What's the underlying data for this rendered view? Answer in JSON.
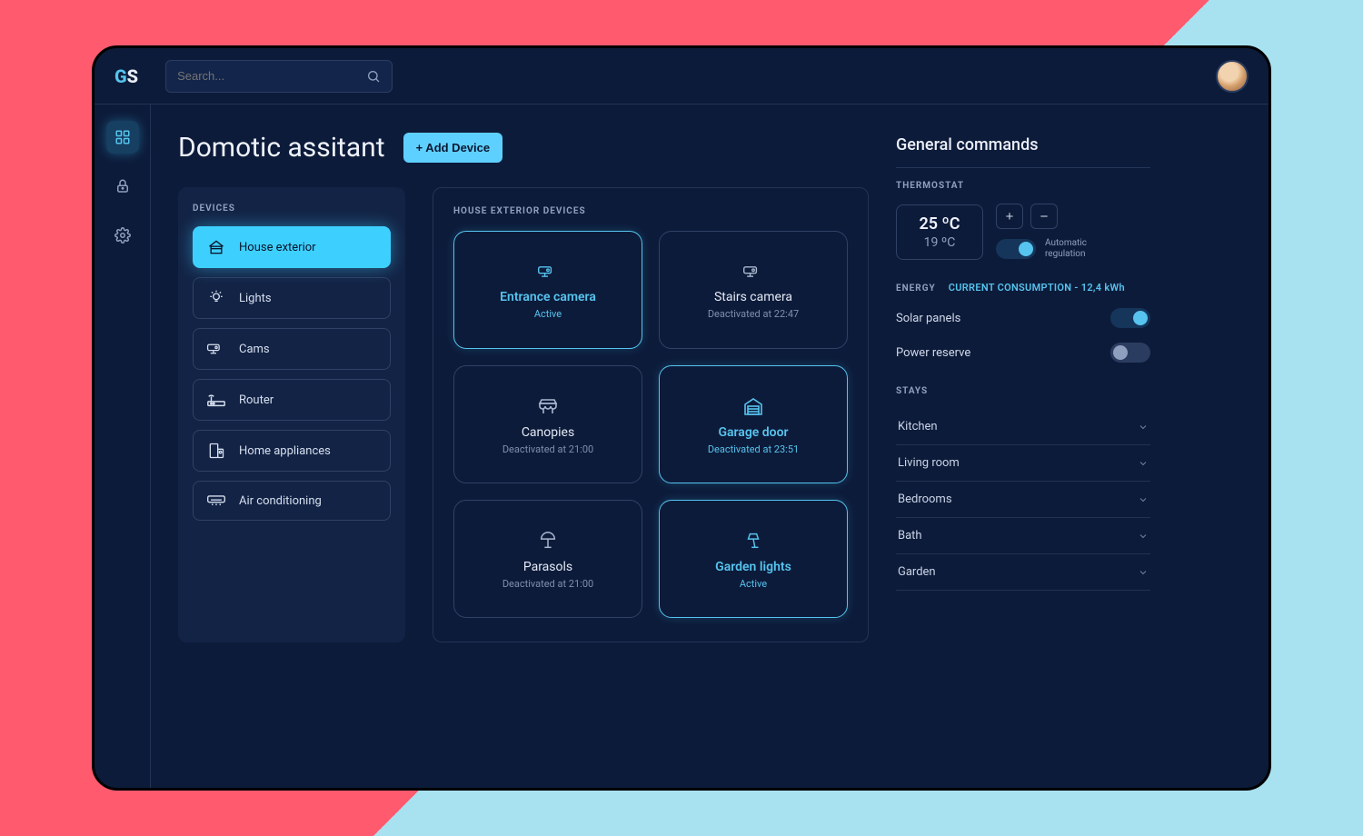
{
  "logo": {
    "g": "G",
    "s": "S"
  },
  "search": {
    "placeholder": "Search..."
  },
  "rail": [
    {
      "name": "dashboard-icon",
      "active": true
    },
    {
      "name": "lock-icon",
      "active": false
    },
    {
      "name": "gear-icon",
      "active": false
    }
  ],
  "page": {
    "title": "Domotic assitant",
    "add_button": "+ Add Device"
  },
  "devices_panel": {
    "label": "DEVICES",
    "items": [
      {
        "icon": "house-icon",
        "label": "House exterior",
        "active": true
      },
      {
        "icon": "lightbulb-icon",
        "label": "Lights",
        "active": false
      },
      {
        "icon": "camera-icon",
        "label": "Cams",
        "active": false
      },
      {
        "icon": "router-icon",
        "label": "Router",
        "active": false
      },
      {
        "icon": "appliance-icon",
        "label": "Home appliances",
        "active": false
      },
      {
        "icon": "ac-icon",
        "label": "Air conditioning",
        "active": false
      }
    ]
  },
  "cards": {
    "label": "HOUSE EXTERIOR DEVICES",
    "items": [
      {
        "icon": "camera-icon",
        "name": "Entrance camera",
        "status": "Active",
        "active": true
      },
      {
        "icon": "camera-icon",
        "name": "Stairs camera",
        "status": "Deactivated at 22:47",
        "active": false
      },
      {
        "icon": "canopy-icon",
        "name": "Canopies",
        "status": "Deactivated at 21:00",
        "active": false
      },
      {
        "icon": "garage-icon",
        "name": "Garage door",
        "status": "Deactivated at 23:51",
        "active": true
      },
      {
        "icon": "parasol-icon",
        "name": "Parasols",
        "status": "Deactivated at 21:00",
        "active": false
      },
      {
        "icon": "lamp-icon",
        "name": "Garden lights",
        "status": "Active",
        "active": true
      }
    ]
  },
  "right": {
    "title": "General commands",
    "thermostat": {
      "label": "THERMOSTAT",
      "current": "25 ºC",
      "target": "19 ºC",
      "plus": "+",
      "minus": "−",
      "auto_label_line1": "Automatic",
      "auto_label_line2": "regulation",
      "auto_on": true
    },
    "energy": {
      "label": "ENERGY",
      "consumption": "CURRENT CONSUMPTION - 12,4 kWh",
      "items": [
        {
          "label": "Solar panels",
          "on": true
        },
        {
          "label": "Power reserve",
          "on": false
        }
      ]
    },
    "stays": {
      "label": "STAYS",
      "items": [
        "Kitchen",
        "Living room",
        "Bedrooms",
        "Bath",
        "Garden"
      ]
    }
  }
}
